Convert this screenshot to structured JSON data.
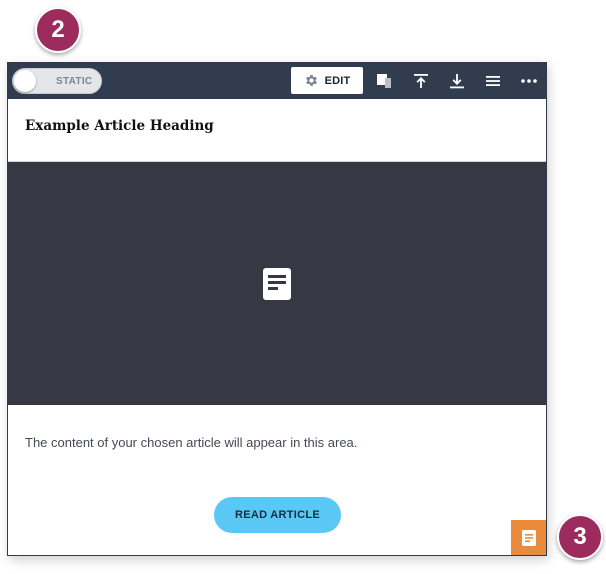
{
  "badges": {
    "step_two": "2",
    "step_three": "3"
  },
  "toolbar": {
    "toggle_label": "STATIC",
    "edit_label": "EDIT",
    "icons": [
      "gear-icon",
      "copy-icon",
      "move-to-top-icon",
      "move-to-bottom-icon",
      "menu-icon",
      "more-icon"
    ]
  },
  "article": {
    "heading": "Example Article Heading",
    "image_placeholder_icon": "document-icon",
    "body": "The content of your chosen article will appear in this area.",
    "read_button": "READ ARTICLE"
  },
  "corner_tab": {
    "icon": "document-icon"
  },
  "colors": {
    "toolbar_bg": "#313d4f",
    "badge": "#9c2c5d",
    "image_bg": "#373844",
    "read_button": "#5ac8f5",
    "corner_tab": "#e98b3a"
  }
}
